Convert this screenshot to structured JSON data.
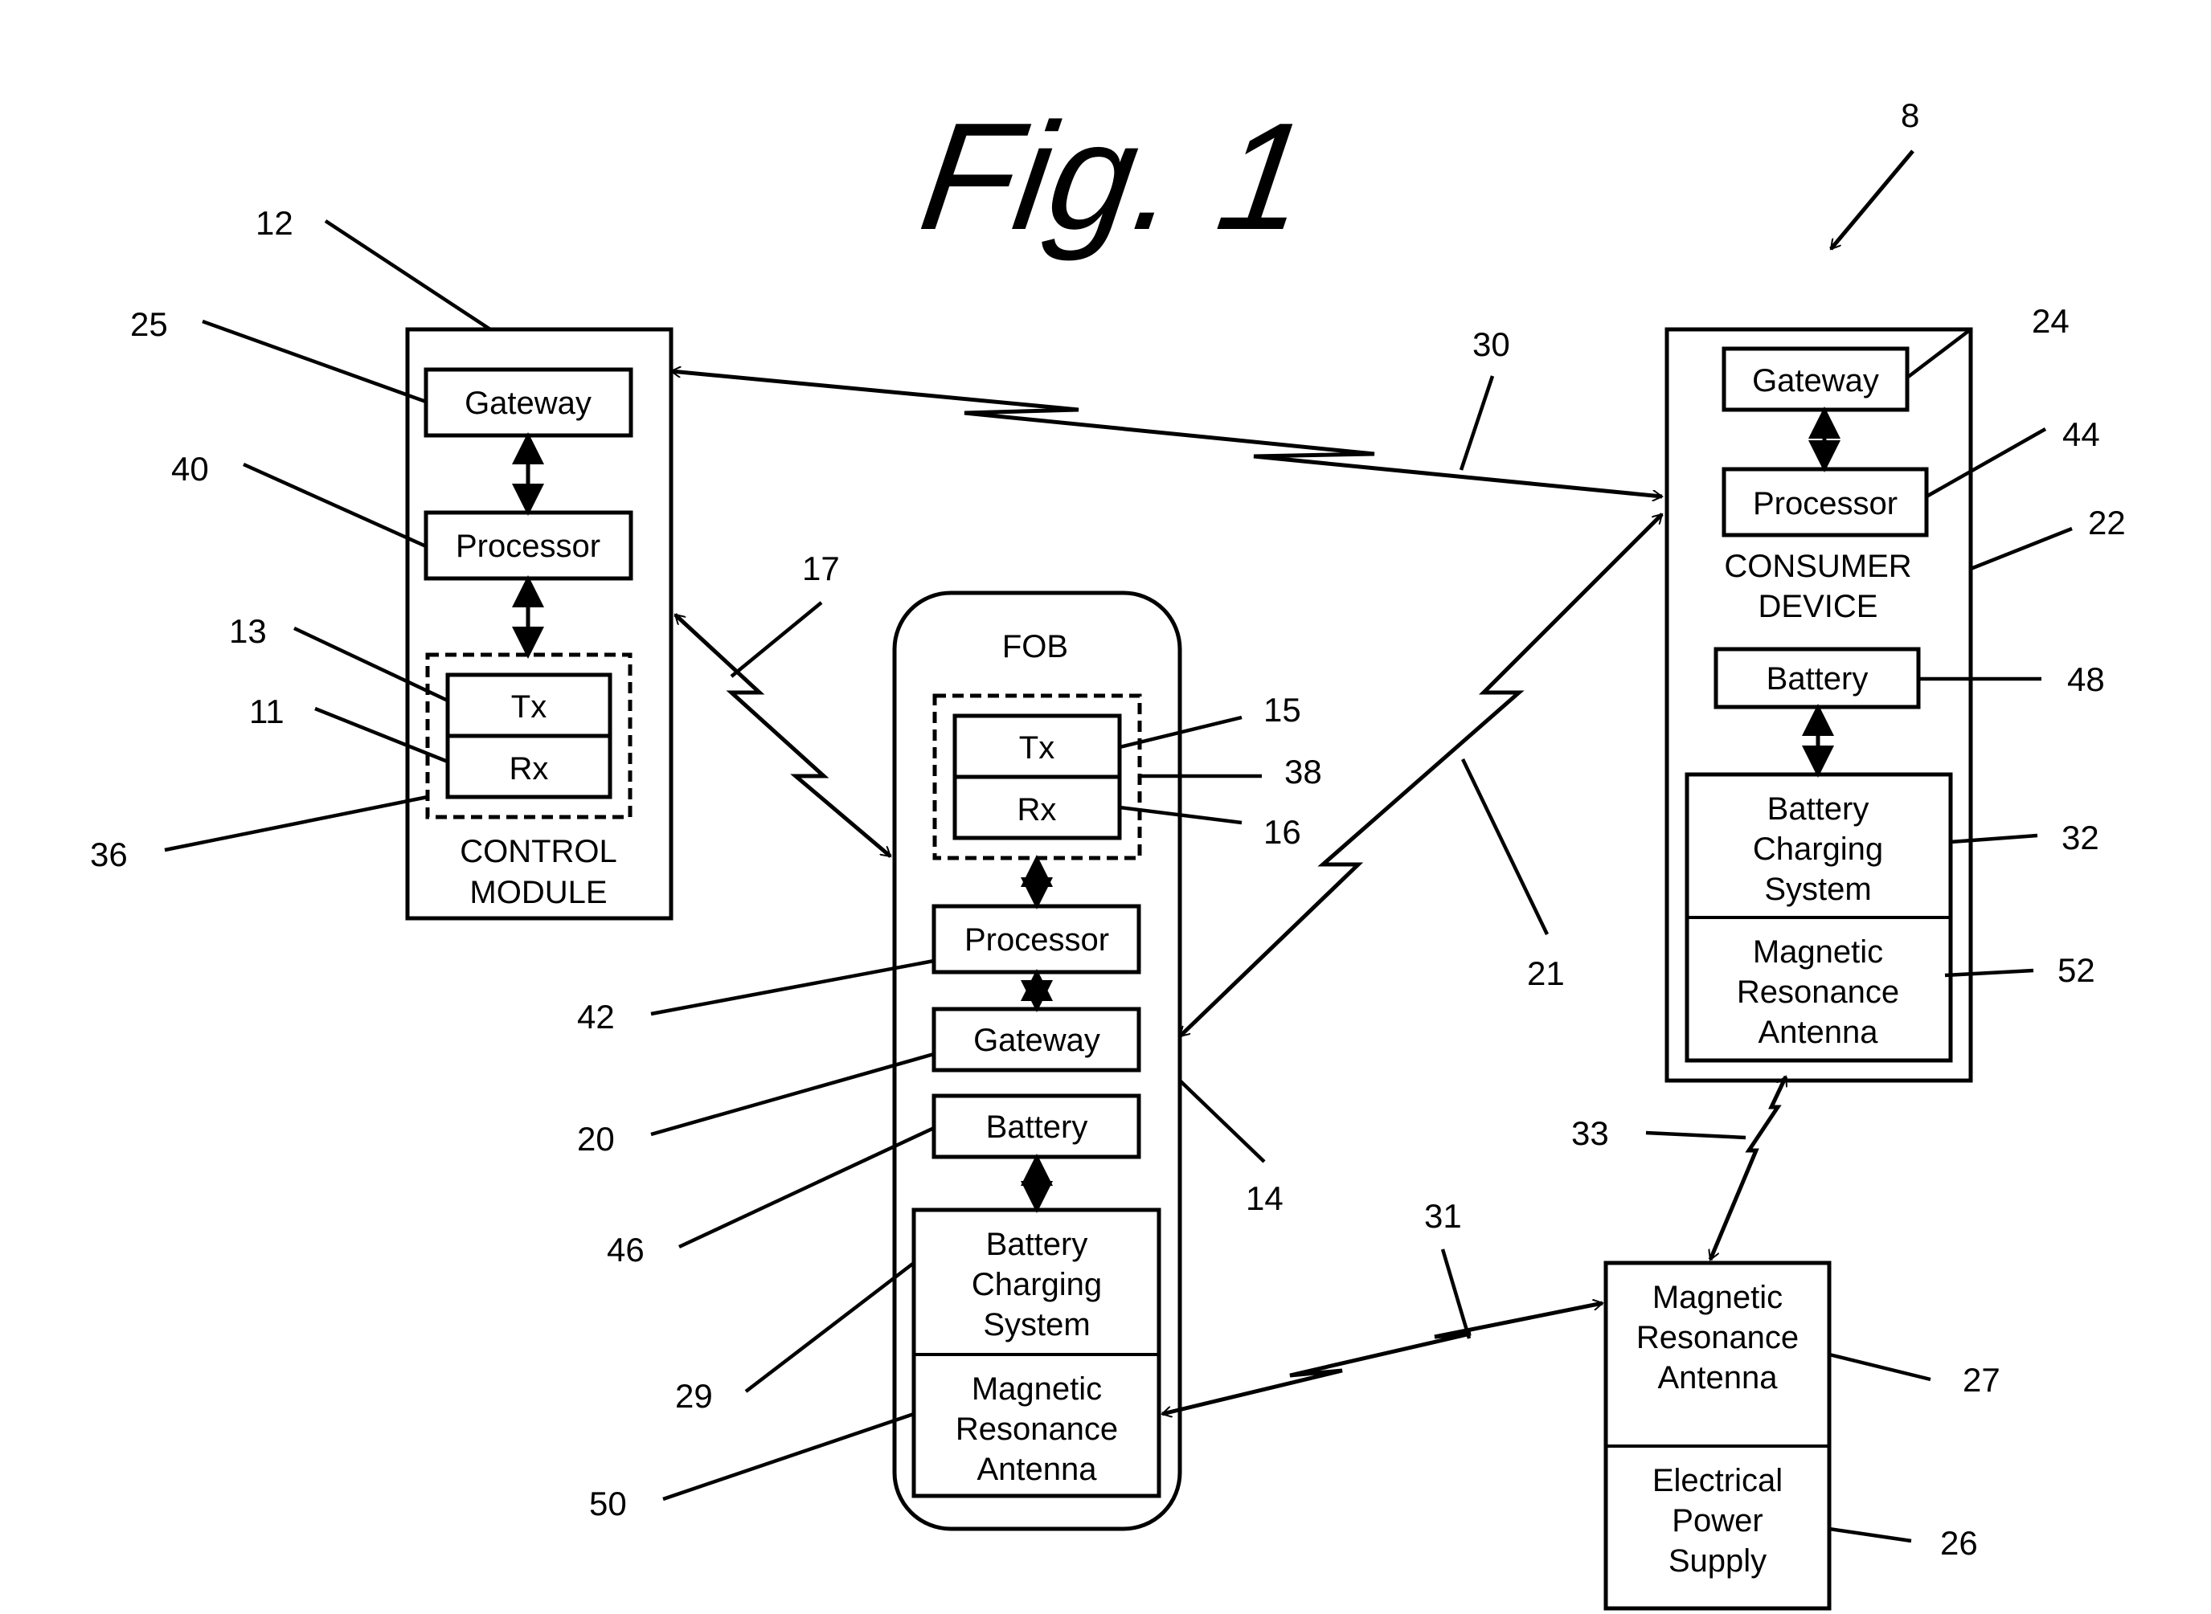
{
  "figure": {
    "title": "Fig. 1",
    "system_ref": "8"
  },
  "control_module": {
    "ref": "12",
    "caption_line1": "CONTROL",
    "caption_line2": "MODULE",
    "gateway": {
      "label": "Gateway",
      "ref": "25"
    },
    "processor": {
      "label": "Processor",
      "ref": "40"
    },
    "transceiver": {
      "ref": "36",
      "tx": {
        "label": "Tx",
        "ref": "13"
      },
      "rx": {
        "label": "Rx",
        "ref": "11"
      }
    }
  },
  "fob": {
    "ref": "14",
    "caption": "FOB",
    "transceiver": {
      "ref": "38",
      "tx": {
        "label": "Tx",
        "ref": "15"
      },
      "rx": {
        "label": "Rx",
        "ref": "16"
      }
    },
    "processor": {
      "label": "Processor",
      "ref": "42"
    },
    "gateway": {
      "label": "Gateway",
      "ref": "20"
    },
    "battery": {
      "label": "Battery",
      "ref": "46"
    },
    "charging": {
      "line1": "Battery",
      "line2": "Charging",
      "line3": "System",
      "ref": "29"
    },
    "antenna": {
      "line1": "Magnetic",
      "line2": "Resonance",
      "line3": "Antenna",
      "ref": "50"
    }
  },
  "consumer_device": {
    "ref": "22",
    "caption_line1": "CONSUMER",
    "caption_line2": "DEVICE",
    "gateway": {
      "label": "Gateway",
      "ref": "24"
    },
    "processor": {
      "label": "Processor",
      "ref": "44"
    },
    "battery": {
      "label": "Battery",
      "ref": "48"
    },
    "charging": {
      "line1": "Battery",
      "line2": "Charging",
      "line3": "System",
      "ref": "32"
    },
    "antenna": {
      "line1": "Magnetic",
      "line2": "Resonance",
      "line3": "Antenna",
      "ref": "52"
    }
  },
  "charger": {
    "antenna": {
      "line1": "Magnetic",
      "line2": "Resonance",
      "line3": "Antenna",
      "ref": "27"
    },
    "power": {
      "line1": "Electrical",
      "line2": "Power",
      "line3": "Supply",
      "ref": "26"
    }
  },
  "links": {
    "control_to_consumer": "30",
    "control_to_fob": "17",
    "fob_to_consumer": "21",
    "fob_to_charger": "31",
    "charger_to_consumer": "33"
  }
}
